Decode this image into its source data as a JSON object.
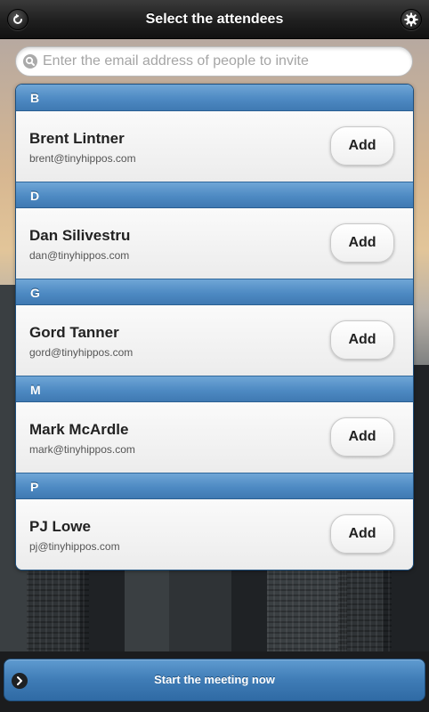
{
  "header": {
    "title": "Select the attendees",
    "back_icon": "back-icon",
    "settings_icon": "gear-icon"
  },
  "search": {
    "placeholder": "Enter the email address of people to invite",
    "value": "",
    "icon": "search-icon"
  },
  "groups": [
    {
      "letter": "B",
      "name": "Brent Lintner",
      "email": "brent@tinyhippos.com",
      "action": "Add"
    },
    {
      "letter": "D",
      "name": "Dan Silivestru",
      "email": "dan@tinyhippos.com",
      "action": "Add"
    },
    {
      "letter": "G",
      "name": "Gord Tanner",
      "email": "gord@tinyhippos.com",
      "action": "Add"
    },
    {
      "letter": "M",
      "name": "Mark McArdle",
      "email": "mark@tinyhippos.com",
      "action": "Add"
    },
    {
      "letter": "P",
      "name": "PJ Lowe",
      "email": "pj@tinyhippos.com",
      "action": "Add"
    }
  ],
  "footer": {
    "start_label": "Start the meeting now",
    "icon": "chevron-right-icon"
  },
  "colors": {
    "accent": "#4e8ac3",
    "header_bg": "#1f1f1f",
    "list_bg": "#f1f1f1"
  }
}
